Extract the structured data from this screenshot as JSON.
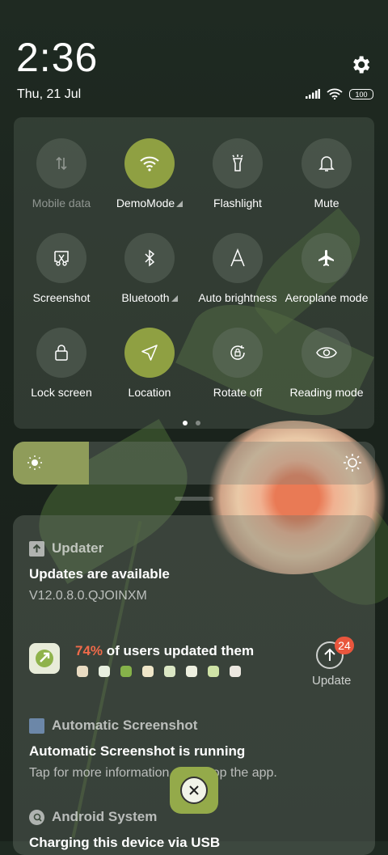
{
  "status": {
    "time": "2:36",
    "date": "Thu, 21 Jul",
    "battery": "100"
  },
  "quick_settings": {
    "tiles": [
      {
        "label": "Mobile data",
        "active": false,
        "icon": "mobile-data-icon"
      },
      {
        "label": "DemoMode",
        "active": true,
        "icon": "wifi-icon"
      },
      {
        "label": "Flashlight",
        "active": false,
        "icon": "flashlight-icon"
      },
      {
        "label": "Mute",
        "active": false,
        "icon": "bell-icon"
      },
      {
        "label": "Screenshot",
        "active": false,
        "icon": "screenshot-icon"
      },
      {
        "label": "Bluetooth",
        "active": false,
        "icon": "bluetooth-icon"
      },
      {
        "label": "Auto brightness",
        "active": false,
        "icon": "auto-brightness-icon"
      },
      {
        "label": "Aeroplane mode",
        "active": false,
        "icon": "airplane-icon"
      },
      {
        "label": "Lock screen",
        "active": false,
        "icon": "lock-icon"
      },
      {
        "label": "Location",
        "active": true,
        "icon": "location-arrow-icon"
      },
      {
        "label": "Rotate off",
        "active": false,
        "icon": "rotate-lock-icon"
      },
      {
        "label": "Reading mode",
        "active": false,
        "icon": "eye-icon"
      }
    ],
    "page_count": 2,
    "current_page": 1
  },
  "brightness": {
    "level": 0.21
  },
  "notifications": {
    "updater": {
      "app": "Updater",
      "title": "Updates are available",
      "version": "V12.0.8.0.QJOINXM",
      "percent": "74%",
      "percent_text": "of users updated them",
      "update_label": "Update",
      "badge": "24"
    },
    "screenshot": {
      "app": "Automatic Screenshot",
      "title": "Automatic Screenshot is running",
      "text": "Tap for more information or to stop the app."
    },
    "android": {
      "app": "Android System",
      "title": "Charging this device via USB"
    }
  },
  "colors": {
    "accent": "#8fa042",
    "badge": "#e9563d",
    "percent": "#f06a4a"
  }
}
